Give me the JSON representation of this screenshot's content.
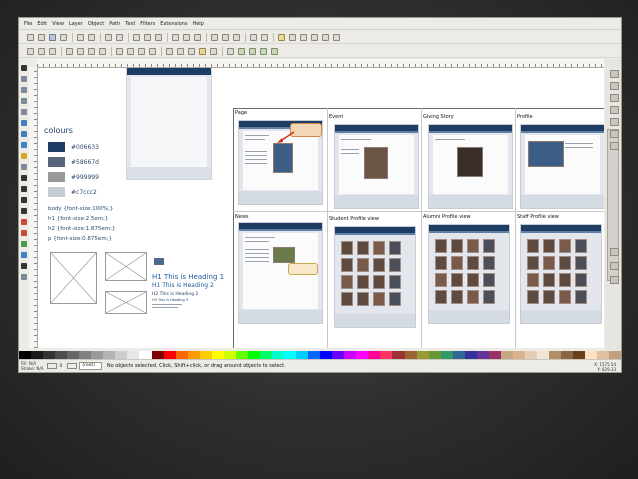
{
  "menubar": {
    "items": [
      "File",
      "Edit",
      "View",
      "Layer",
      "Object",
      "Path",
      "Text",
      "Filters",
      "Extensions",
      "Help"
    ]
  },
  "icons": {
    "toolbar": [
      "new-document-icon",
      "open-icon",
      "save-icon",
      "print-icon",
      "import-icon",
      "export-icon",
      "undo-icon",
      "redo-icon",
      "copy-icon",
      "cut-icon",
      "paste-icon",
      "zoom-icon",
      "duplicate-icon",
      "clone-icon",
      "group-icon",
      "ungroup-icon",
      "fill-stroke-icon",
      "text-tool-icon",
      "layers-icon",
      "xml-editor-icon",
      "align-icon",
      "preferences-icon"
    ],
    "tools": [
      "selector-tool-icon",
      "node-tool-icon",
      "tweak-tool-icon",
      "zoom-tool-icon",
      "measure-tool-icon",
      "rect-tool-icon",
      "3dbox-tool-icon",
      "ellipse-tool-icon",
      "star-tool-icon",
      "spiral-tool-icon",
      "pencil-tool-icon",
      "pen-tool-icon",
      "calligraphy-tool-icon",
      "text-tool-icon",
      "spray-tool-icon",
      "eraser-tool-icon",
      "bucket-tool-icon",
      "gradient-tool-icon",
      "dropper-tool-icon",
      "connector-tool-icon"
    ]
  },
  "colours": {
    "title": "colours",
    "items": [
      {
        "label": "#006633",
        "color": "#1d3d64"
      },
      {
        "label": "#58667d",
        "color": "#58667d"
      },
      {
        "label": "#999999",
        "color": "#999999"
      },
      {
        "label": "#c7ccc2",
        "color": "#c7ccd2"
      }
    ]
  },
  "css_rules": [
    "body {font-size:100%;}",
    "h1 {font-size:2.5em;}",
    "h2 {font-size:1.875em;}",
    "p {font-size:0.875em;}"
  ],
  "headings": {
    "h1_sample": "H1 This is Heading 1",
    "h1_sample_2": "H1 This is Heading 2",
    "h2_sample": "H2 This is Heading 2",
    "h3_sample": "H3 This is Heading 3"
  },
  "panels": [
    {
      "label": "Page"
    },
    {
      "label": "Event"
    },
    {
      "label": "Giving Story"
    },
    {
      "label": "Profile"
    },
    {
      "label": "News"
    },
    {
      "label": "Student Profile view"
    },
    {
      "label": "Alumni Profile view"
    },
    {
      "label": "Staff Profile view"
    }
  ],
  "statusbar": {
    "fill_label": "Fill:",
    "stroke_label": "Stroke:",
    "fill_value": "N/A",
    "stroke_value": "N/A",
    "opacity": "0",
    "layer": "(root)",
    "message": "No objects selected. Click, Shift+click, or drag around objects to select.",
    "coords_x": "X: 1575.54",
    "coords_y": "Y: 829.33",
    "zoom": "Z: 27%"
  },
  "palette": [
    "#000000",
    "#1a1a1a",
    "#333333",
    "#4d4d4d",
    "#666666",
    "#808080",
    "#999999",
    "#b3b3b3",
    "#cccccc",
    "#e6e6e6",
    "#ffffff",
    "#800000",
    "#ff0000",
    "#ff6600",
    "#ff9900",
    "#ffcc00",
    "#ffff00",
    "#ccff00",
    "#66ff00",
    "#00ff00",
    "#00ff66",
    "#00ffcc",
    "#00ffff",
    "#00ccff",
    "#0066ff",
    "#0000ff",
    "#6600ff",
    "#cc00ff",
    "#ff00ff",
    "#ff0099",
    "#ff3366",
    "#993333",
    "#996633",
    "#999933",
    "#669933",
    "#339966",
    "#336699",
    "#333399",
    "#663399",
    "#993366",
    "#c8a882",
    "#d9b38c",
    "#e6ccb3",
    "#f2e6d9",
    "#b38f66",
    "#8c6640",
    "#66401a",
    "#ffe0c0",
    "#e0c0a0",
    "#c0a080"
  ]
}
